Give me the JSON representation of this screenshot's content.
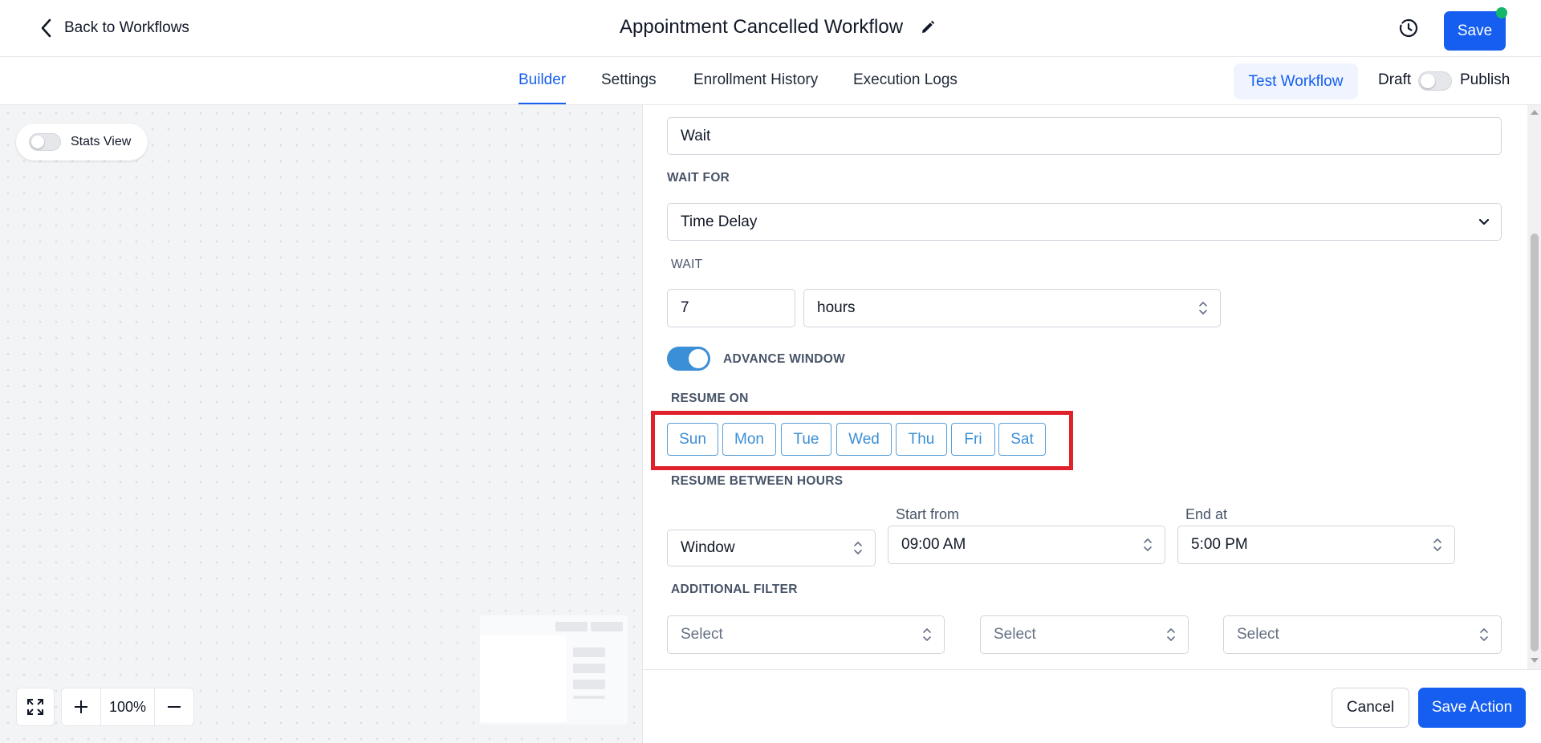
{
  "header": {
    "back_label": "Back to Workflows",
    "title": "Appointment Cancelled Workflow",
    "save_label": "Save"
  },
  "tabs": [
    {
      "label": "Builder",
      "active": true
    },
    {
      "label": "Settings",
      "active": false
    },
    {
      "label": "Enrollment History",
      "active": false
    },
    {
      "label": "Execution Logs",
      "active": false
    }
  ],
  "toolbar": {
    "test_label": "Test Workflow",
    "draft_label": "Draft",
    "publish_label": "Publish",
    "published": false
  },
  "canvas": {
    "stats_view_label": "Stats View",
    "stats_view_on": false,
    "zoom_level": "100%"
  },
  "form": {
    "action_name": "Wait",
    "wait_for_label": "WAIT FOR",
    "wait_for_value": "Time Delay",
    "wait_label": "WAIT",
    "wait_amount": "7",
    "wait_unit": "hours",
    "advance_window_label": "ADVANCE WINDOW",
    "advance_window_on": true,
    "resume_on_label": "RESUME ON",
    "days": [
      "Sun",
      "Mon",
      "Tue",
      "Wed",
      "Thu",
      "Fri",
      "Sat"
    ],
    "resume_between_label": "RESUME BETWEEN HOURS",
    "window_type": "Window",
    "start_label": "Start from",
    "start_value": "09:00 AM",
    "end_label": "End at",
    "end_value": "5:00 PM",
    "additional_filter_label": "ADDITIONAL FILTER",
    "filter_placeholders": [
      "Select",
      "Select",
      "Select"
    ]
  },
  "footer": {
    "cancel_label": "Cancel",
    "save_action_label": "Save Action"
  },
  "colors": {
    "primary": "#155eef",
    "day_button": "#3b8fd6",
    "highlight": "#e0202a",
    "status_dot": "#12b76a"
  }
}
